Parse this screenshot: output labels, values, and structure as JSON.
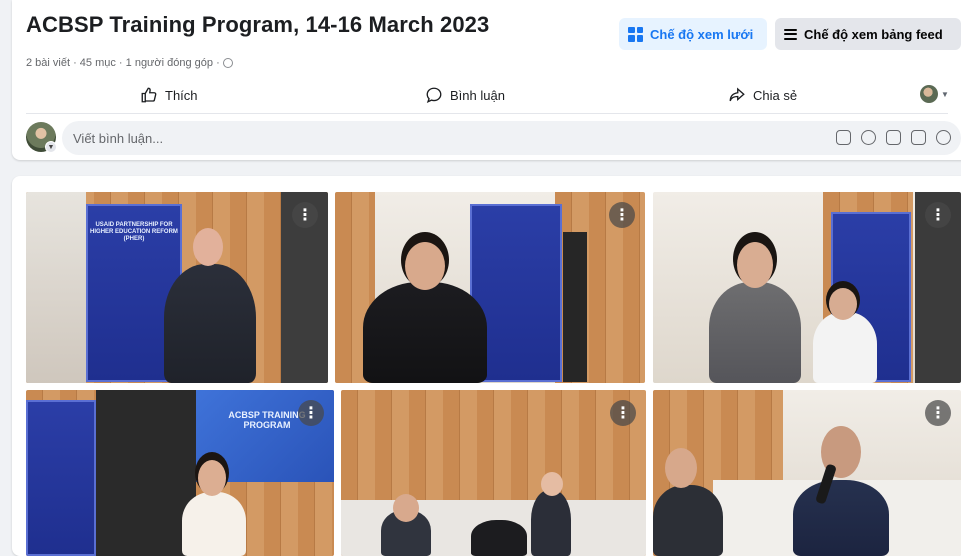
{
  "album": {
    "title": "ACBSP Training Program, 14-16 March 2023",
    "meta": "2 bài viết · 45 mục · 1 người đóng góp ·"
  },
  "view_buttons": {
    "grid_label": "Chế độ xem lưới",
    "feed_label": "Chế độ xem bảng feed"
  },
  "actions": {
    "like": "Thích",
    "comment": "Bình luận",
    "share": "Chia sẻ"
  },
  "comment": {
    "placeholder": "Viết bình luận..."
  },
  "icons": {
    "grid": "grid-icon",
    "feed": "list-icon",
    "like": "thumbs-up-icon",
    "comment": "speech-bubble-icon",
    "share": "share-arrow-icon",
    "privacy": "globe-icon",
    "comment_tools": [
      "avatar-sticker-icon",
      "emoji-icon",
      "camera-icon",
      "gif-icon",
      "sticker-icon"
    ]
  },
  "photos": [
    {
      "label": "Speaker man in suit presenting"
    },
    {
      "label": "Woman speaker holding microphone"
    },
    {
      "label": "Woman in gray blazer speaking"
    },
    {
      "label": "Woman presenting in front of screen"
    },
    {
      "label": "Audience seated at training"
    },
    {
      "label": "Man in audience with microphone"
    }
  ],
  "banner_texts": [
    "USAID PARTNERSHIP FOR HIGHER EDUCATION REFORM (PHER)",
    "ACBSP TRAINING PROGRAM"
  ],
  "colors": {
    "accent": "#1877f2",
    "accent_bg": "#e7f3ff",
    "page_bg": "#f0f2f5"
  }
}
